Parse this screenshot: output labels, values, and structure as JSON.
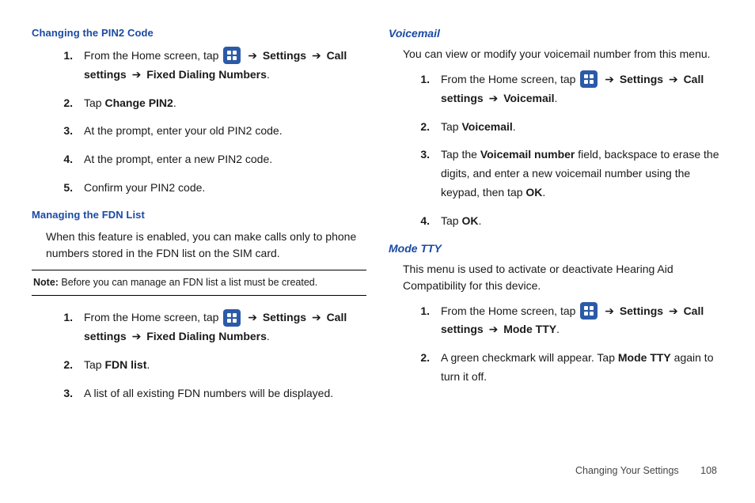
{
  "footer": {
    "section": "Changing Your Settings",
    "page": "108"
  },
  "left": {
    "h1": "Changing the PIN2 Code",
    "steps1": [
      {
        "n": "1.",
        "pre": "From the Home screen, tap ",
        "path": [
          "Settings",
          "Call settings",
          "Fixed Dialing Numbers"
        ],
        "tail": "."
      },
      {
        "n": "2.",
        "plainPre": "Tap ",
        "boldTail": "Change PIN2",
        "tail": "."
      },
      {
        "n": "3.",
        "plain": "At the prompt, enter your old PIN2 code."
      },
      {
        "n": "4.",
        "plain": "At the prompt, enter a new PIN2 code."
      },
      {
        "n": "5.",
        "plain": "Confirm your PIN2 code."
      }
    ],
    "h2": "Managing the FDN List",
    "p2": "When this feature is enabled, you can make calls only to phone numbers stored in the FDN list on the SIM card.",
    "noteLabel": "Note:",
    "noteText": " Before you can manage an FDN list a list must be created.",
    "steps2": [
      {
        "n": "1.",
        "pre": "From the Home screen, tap ",
        "path": [
          "Settings",
          "Call settings",
          "Fixed Dialing Numbers"
        ],
        "tail": "."
      },
      {
        "n": "2.",
        "plainPre": "Tap ",
        "boldTail": "FDN list",
        "tail": "."
      },
      {
        "n": "3.",
        "plain": "A list of all existing FDN numbers will be displayed."
      }
    ]
  },
  "right": {
    "h1": "Voicemail",
    "p1": "You can view or modify your voicemail number from this menu.",
    "steps1": [
      {
        "n": "1.",
        "pre": "From the Home screen, tap ",
        "path": [
          "Settings",
          "Call settings",
          "Voicemail"
        ],
        "tail": "."
      },
      {
        "n": "2.",
        "plainPre": "Tap ",
        "boldTail": "Voicemail",
        "tail": "."
      },
      {
        "n": "3.",
        "plainPre": "Tap the ",
        "boldMid": "Voicemail number",
        "midTail": " field, backspace to erase the digits, and enter a new voicemail number using the keypad, then tap ",
        "boldTail": "OK",
        "tail": "."
      },
      {
        "n": "4.",
        "plainPre": "Tap ",
        "boldTail": "OK",
        "tail": "."
      }
    ],
    "h2": "Mode TTY",
    "p2": "This menu is used to activate or deactivate Hearing Aid Compatibility for this device.",
    "steps2": [
      {
        "n": "1.",
        "pre": "From the Home screen, tap ",
        "path": [
          "Settings",
          "Call settings",
          "Mode TTY"
        ],
        "tail": "."
      },
      {
        "n": "2.",
        "plainPre": "A green checkmark will appear. Tap ",
        "boldMid": "Mode TTY",
        "midTail": " again to turn it off."
      }
    ]
  },
  "arrowGlyph": "➔"
}
